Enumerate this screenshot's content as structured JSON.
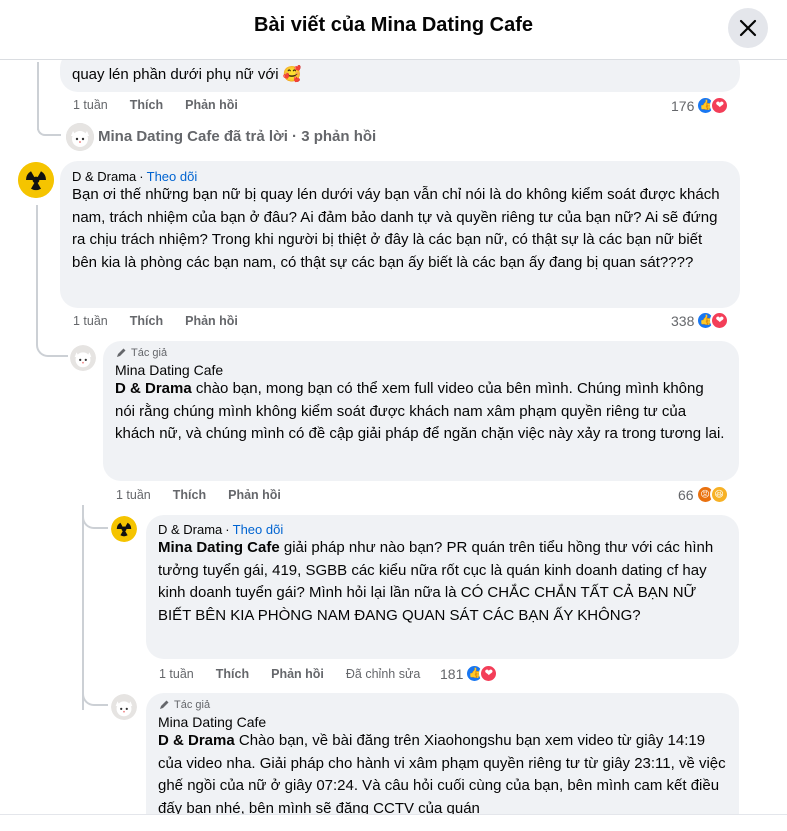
{
  "header": {
    "title": "Bài viết của Mina Dating Cafe"
  },
  "comments": [
    {
      "text": "quay lén phần dưới phụ nữ với 🥰",
      "time": "1 tuần",
      "like": "Thích",
      "reply": "Phản hồi",
      "reactions": "176"
    },
    {
      "reply_summary": "Mina Dating Cafe đã trả lời · 3 phản hồi"
    },
    {
      "author": "D & Drama",
      "sep": "·",
      "follow": "Theo dõi",
      "text": "Bạn ơi thế những bạn nữ bị quay lén dưới váy bạn vẫn chỉ nói là do không kiểm soát được khách nam, trách nhiệm của bạn ở đâu? Ai đảm bảo danh tự và quyền riêng tư của bạn nữ? Ai sẽ đứng ra chịu trách nhiệm? Trong khi người bị thiệt ở đây là các bạn nữ, có thật sự là các bạn nữ biết bên kia là phòng các bạn nam, có thật sự các bạn ấy biết là các bạn ấy đang bị quan sát????",
      "time": "1 tuần",
      "like": "Thích",
      "reply": "Phản hồi",
      "reactions": "338"
    },
    {
      "badge": "Tác giả",
      "author": "Mina Dating Cafe",
      "tag": "D & Drama",
      "text": " chào bạn, mong bạn có thể xem full video của bên mình. Chúng mình không nói rằng chúng mình không kiểm soát được khách nam xâm phạm quyền riêng tư của khách nữ, và chúng mình có đề cập giải pháp để ngăn chặn việc này xảy ra trong tương lai.",
      "time": "1 tuần",
      "like": "Thích",
      "reply": "Phản hồi",
      "reactions": "66"
    },
    {
      "author": "D & Drama",
      "sep": "·",
      "follow": "Theo dõi",
      "tag": "Mina Dating Cafe",
      "text": " giải pháp như nào bạn? PR quán trên tiểu hồng thư với các hình tưởng tuyển gái, 419, SGBB các kiểu nữa rốt cục là quán kinh doanh dating cf hay kinh doanh tuyển gái? Mình hỏi lại lần nữa là CÓ CHẮC CHẮN TẤT CẢ BẠN NỮ BIẾT BÊN KIA PHÒNG NAM ĐANG QUAN SÁT CÁC BẠN ẤY KHÔNG?",
      "time": "1 tuần",
      "like": "Thích",
      "reply": "Phản hồi",
      "edited": "Đã chỉnh sửa",
      "reactions": "181"
    },
    {
      "badge": "Tác giả",
      "author": "Mina Dating Cafe",
      "tag": "D & Drama",
      "text": " Chào bạn, về bài đăng trên Xiaohongshu bạn xem video từ giây 14:19 của video nha. Giải pháp cho hành vi xâm phạm quyền riêng tư từ giây 23:11, về việc ghế ngồi của nữ ở giây 07:24. Và câu hỏi cuối cùng của bạn, bên mình cam kết điều đấy bạn nhé, bên mình sẽ đăng CCTV của quán"
    }
  ],
  "icons": {
    "close": "close-icon",
    "like": "like-reaction-icon",
    "love": "love-reaction-icon",
    "angry": "angry-reaction-icon",
    "haha": "haha-reaction-icon",
    "pen": "pen-icon",
    "avatar_cat": "cat-avatar",
    "avatar_radiation": "radiation-avatar"
  },
  "colors": {
    "like": "#1877f2",
    "love": "#f33e58",
    "angry": "#e9710f",
    "haha": "#f7b125",
    "link": "#0064d1"
  }
}
